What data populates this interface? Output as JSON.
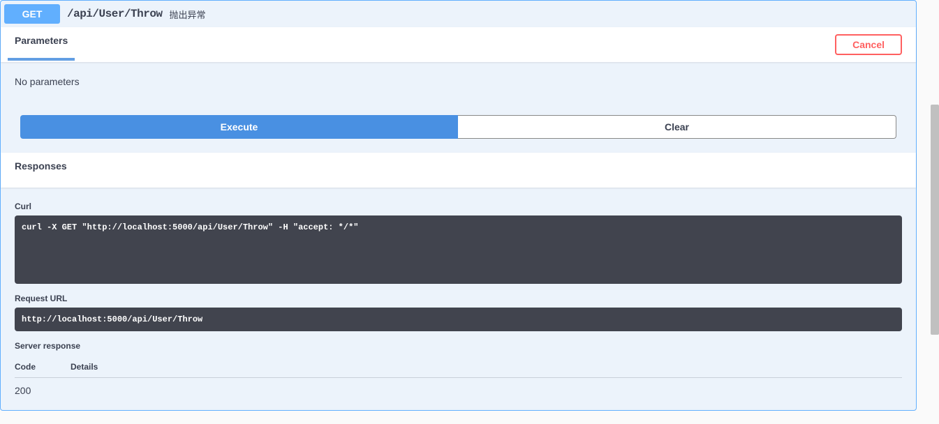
{
  "operation": {
    "method": "GET",
    "path": "/api/User/Throw",
    "description": "抛出异常"
  },
  "parameters": {
    "tab_label": "Parameters",
    "cancel_label": "Cancel",
    "empty_text": "No parameters"
  },
  "actions": {
    "execute_label": "Execute",
    "clear_label": "Clear"
  },
  "responses": {
    "header": "Responses",
    "curl_label": "Curl",
    "curl_command": "curl -X GET \"http://localhost:5000/api/User/Throw\" -H \"accept: */*\"",
    "request_url_label": "Request URL",
    "request_url": "http://localhost:5000/api/User/Throw",
    "server_response_label": "Server response",
    "table": {
      "code_header": "Code",
      "details_header": "Details"
    },
    "status_code": "200"
  }
}
